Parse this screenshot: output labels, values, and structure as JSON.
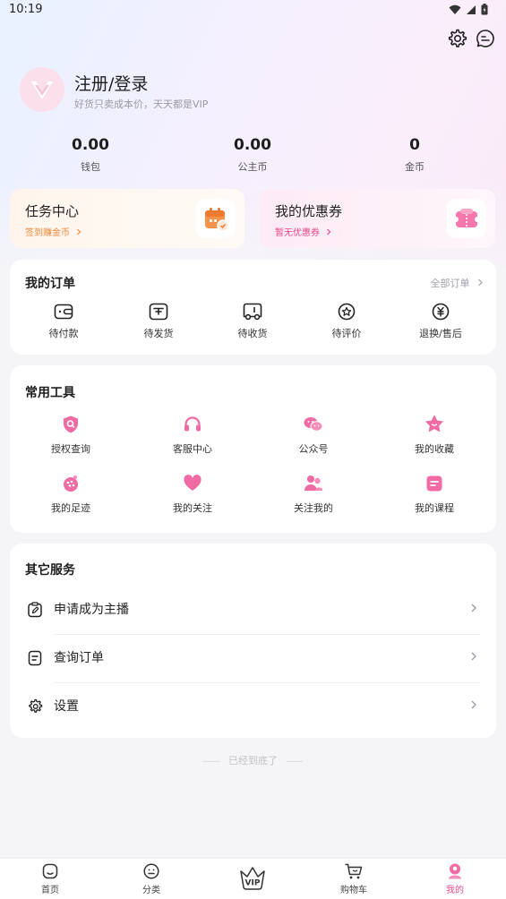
{
  "status": {
    "time": "10:19"
  },
  "profile": {
    "title": "注册/登录",
    "subtitle": "好货只卖成本价，天天都是VIP"
  },
  "stats": [
    {
      "value": "0.00",
      "label": "钱包"
    },
    {
      "value": "0.00",
      "label": "公主币"
    },
    {
      "value": "0",
      "label": "金币"
    }
  ],
  "promos": {
    "task": {
      "title": "任务中心",
      "sub": "签到赚金币",
      "accent": "#f08a3c"
    },
    "coupon": {
      "title": "我的优惠券",
      "sub": "暂无优惠券",
      "accent": "#e8478a"
    }
  },
  "orders": {
    "title": "我的订单",
    "all_label": "全部订单",
    "items": [
      {
        "label": "待付款",
        "icon": "wallet-icon"
      },
      {
        "label": "待发货",
        "icon": "box-icon"
      },
      {
        "label": "待收货",
        "icon": "truck-icon"
      },
      {
        "label": "待评价",
        "icon": "review-icon"
      },
      {
        "label": "退换/售后",
        "icon": "refund-icon"
      }
    ]
  },
  "tools": {
    "title": "常用工具",
    "items": [
      {
        "label": "授权查询",
        "icon": "shield-search-icon"
      },
      {
        "label": "客服中心",
        "icon": "headset-icon"
      },
      {
        "label": "公众号",
        "icon": "wechat-icon"
      },
      {
        "label": "我的收藏",
        "icon": "star-icon"
      },
      {
        "label": "我的足迹",
        "icon": "footprint-icon"
      },
      {
        "label": "我的关注",
        "icon": "heart-icon"
      },
      {
        "label": "关注我的",
        "icon": "users-icon"
      },
      {
        "label": "我的课程",
        "icon": "course-icon"
      }
    ]
  },
  "services": {
    "title": "其它服务",
    "items": [
      {
        "label": "申请成为主播",
        "icon": "apply-icon"
      },
      {
        "label": "查询订单",
        "icon": "order-query-icon"
      },
      {
        "label": "设置",
        "icon": "gear-icon"
      }
    ]
  },
  "footer_note": "已经到底了",
  "tabs": [
    {
      "label": "首页",
      "icon": "home-icon"
    },
    {
      "label": "分类",
      "icon": "category-icon"
    },
    {
      "label": "VIP",
      "icon": "vip-crown-icon"
    },
    {
      "label": "购物车",
      "icon": "cart-icon"
    },
    {
      "label": "我的",
      "icon": "profile-icon",
      "active": true
    }
  ],
  "colors": {
    "brand_pink": "#ea4d8f",
    "accent_orange": "#f08a3c"
  }
}
